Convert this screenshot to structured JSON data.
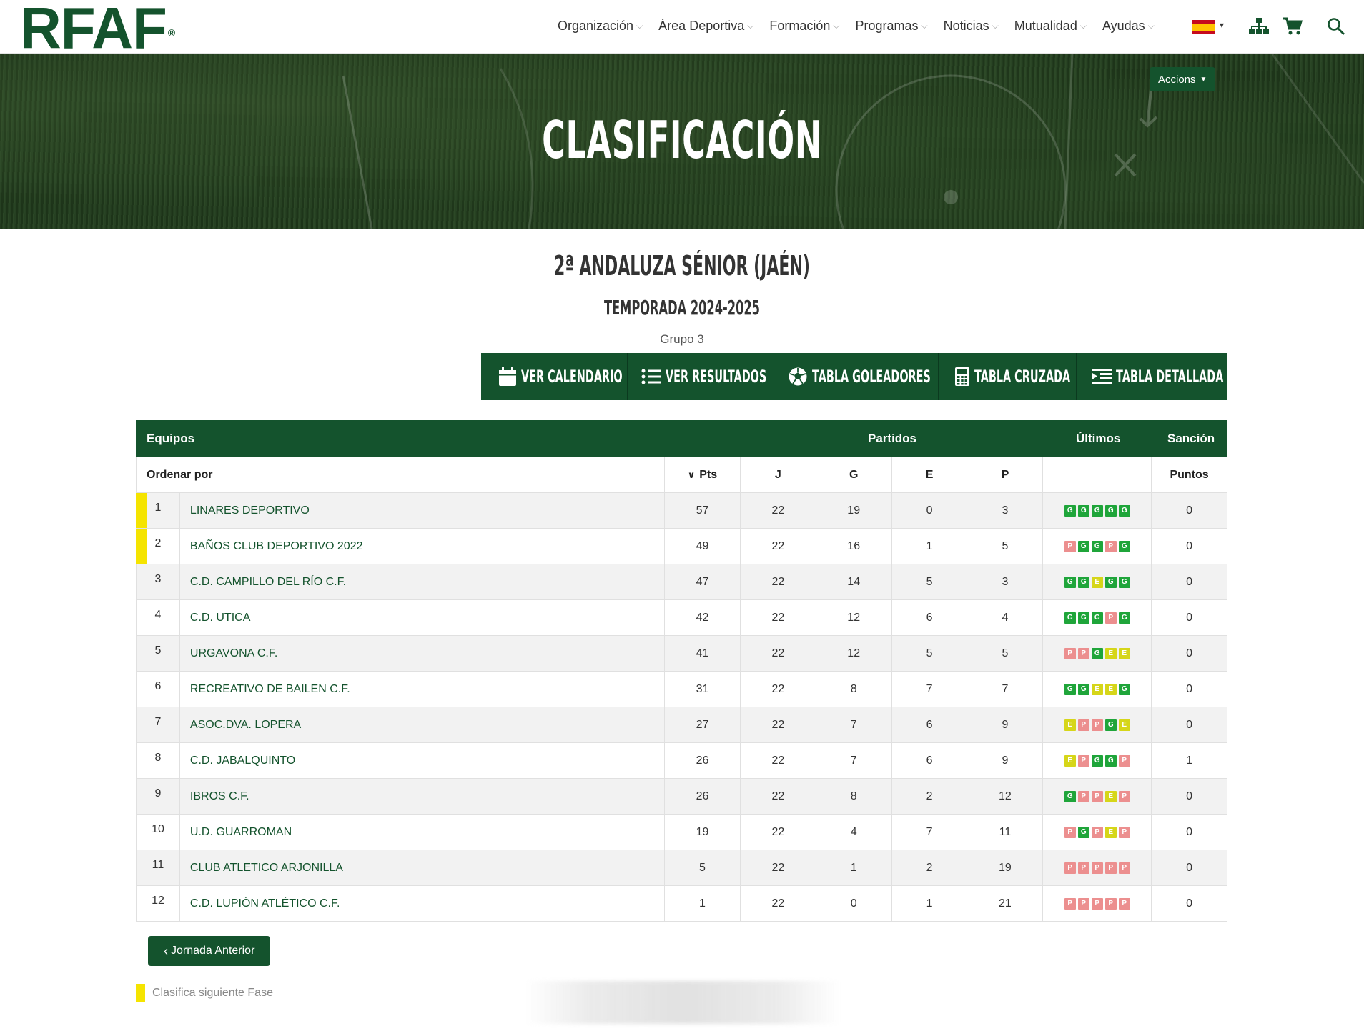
{
  "header": {
    "logo": "RFAF",
    "logo_mark": "®",
    "nav": [
      "Organización",
      "Área Deportiva",
      "Formación",
      "Programas",
      "Noticias",
      "Mutualidad",
      "Ayudas"
    ],
    "icons": [
      "spain-flag-icon",
      "sitemap-icon",
      "cart-icon",
      "search-icon"
    ]
  },
  "hero": {
    "title": "CLASIFICACIÓN",
    "actions_label": "Accions"
  },
  "competition": {
    "title": "2ª ANDALUZA SÉNIOR (JAÉN)",
    "season": "TEMPORADA 2024-2025",
    "group": "Grupo 3"
  },
  "buttons": [
    "VER CALENDARIO",
    "VER RESULTADOS",
    "TABLA GOLEADORES",
    "TABLA CRUZADA",
    "TABLA DETALLADA"
  ],
  "table": {
    "headers": {
      "teams": "Equipos",
      "matches": "Partidos",
      "last": "Últimos",
      "sanction": "Sanción"
    },
    "subheaders": {
      "order_by": "Ordenar por",
      "pts": "Pts",
      "j": "J",
      "g": "G",
      "e": "E",
      "p": "P",
      "points": "Puntos"
    },
    "rows": [
      {
        "pos": "1",
        "team": "LINARES DEPORTIVO",
        "pts": "57",
        "j": "22",
        "g": "19",
        "e": "0",
        "p": "3",
        "last": [
          "G",
          "G",
          "G",
          "G",
          "G"
        ],
        "sanction": "0",
        "qualifies": true
      },
      {
        "pos": "2",
        "team": "BAÑOS CLUB DEPORTIVO 2022",
        "pts": "49",
        "j": "22",
        "g": "16",
        "e": "1",
        "p": "5",
        "last": [
          "P",
          "G",
          "G",
          "P",
          "G"
        ],
        "sanction": "0",
        "qualifies": true
      },
      {
        "pos": "3",
        "team": "C.D. CAMPILLO DEL RÍO C.F.",
        "pts": "47",
        "j": "22",
        "g": "14",
        "e": "5",
        "p": "3",
        "last": [
          "G",
          "G",
          "E",
          "G",
          "G"
        ],
        "sanction": "0",
        "qualifies": false
      },
      {
        "pos": "4",
        "team": "C.D. UTICA",
        "pts": "42",
        "j": "22",
        "g": "12",
        "e": "6",
        "p": "4",
        "last": [
          "G",
          "G",
          "G",
          "P",
          "G"
        ],
        "sanction": "0",
        "qualifies": false
      },
      {
        "pos": "5",
        "team": "URGAVONA C.F.",
        "pts": "41",
        "j": "22",
        "g": "12",
        "e": "5",
        "p": "5",
        "last": [
          "P",
          "P",
          "G",
          "E",
          "E"
        ],
        "sanction": "0",
        "qualifies": false
      },
      {
        "pos": "6",
        "team": "RECREATIVO DE BAILEN C.F.",
        "pts": "31",
        "j": "22",
        "g": "8",
        "e": "7",
        "p": "7",
        "last": [
          "G",
          "G",
          "E",
          "E",
          "G"
        ],
        "sanction": "0",
        "qualifies": false
      },
      {
        "pos": "7",
        "team": "ASOC.DVA. LOPERA",
        "pts": "27",
        "j": "22",
        "g": "7",
        "e": "6",
        "p": "9",
        "last": [
          "E",
          "P",
          "P",
          "G",
          "E"
        ],
        "sanction": "0",
        "qualifies": false
      },
      {
        "pos": "8",
        "team": "C.D. JABALQUINTO",
        "pts": "26",
        "j": "22",
        "g": "7",
        "e": "6",
        "p": "9",
        "last": [
          "E",
          "P",
          "G",
          "G",
          "P"
        ],
        "sanction": "1",
        "qualifies": false
      },
      {
        "pos": "9",
        "team": "IBROS C.F.",
        "pts": "26",
        "j": "22",
        "g": "8",
        "e": "2",
        "p": "12",
        "last": [
          "G",
          "P",
          "P",
          "E",
          "P"
        ],
        "sanction": "0",
        "qualifies": false
      },
      {
        "pos": "10",
        "team": "U.D. GUARROMAN",
        "pts": "19",
        "j": "22",
        "g": "4",
        "e": "7",
        "p": "11",
        "last": [
          "P",
          "G",
          "P",
          "E",
          "P"
        ],
        "sanction": "0",
        "qualifies": false
      },
      {
        "pos": "11",
        "team": "CLUB ATLETICO ARJONILLA",
        "pts": "5",
        "j": "22",
        "g": "1",
        "e": "2",
        "p": "19",
        "last": [
          "P",
          "P",
          "P",
          "P",
          "P"
        ],
        "sanction": "0",
        "qualifies": false
      },
      {
        "pos": "12",
        "team": "C.D. LUPIÓN ATLÉTICO C.F.",
        "pts": "1",
        "j": "22",
        "g": "0",
        "e": "1",
        "p": "21",
        "last": [
          "P",
          "P",
          "P",
          "P",
          "P"
        ],
        "sanction": "0",
        "qualifies": false
      }
    ]
  },
  "footer": {
    "prev_button": "Jornada Anterior",
    "legend": "Clasifica siguiente Fase"
  },
  "colors": {
    "brand": "#14532d",
    "qualify": "#f5e400",
    "win": "#1fa53a",
    "draw": "#d6d619",
    "loss": "#ec8f8f"
  }
}
